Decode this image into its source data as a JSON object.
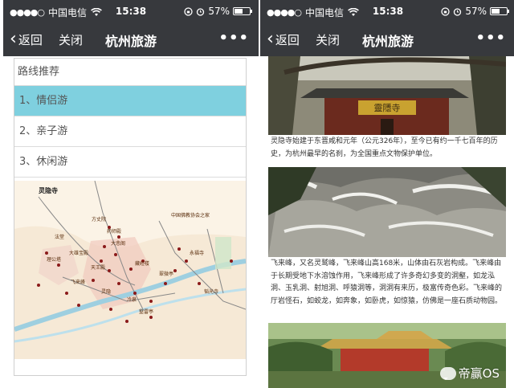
{
  "status_bar": {
    "signal_dots": "●●●●○",
    "carrier": "中国电信",
    "time": "15:38",
    "battery_percent": "57%",
    "battery_level": 0.57
  },
  "nav": {
    "back_label": "返回",
    "close_label": "关闭",
    "title": "杭州旅游",
    "more_label": "•••"
  },
  "routes": {
    "header": "路线推荐",
    "items": [
      {
        "label": "1、情侣游",
        "active": true
      },
      {
        "label": "2、亲子游",
        "active": false
      },
      {
        "label": "3、休闲游",
        "active": false
      }
    ]
  },
  "map": {
    "labels": [
      "灵隐寺",
      "中国佛教协会之家",
      "方丈院",
      "药师殿",
      "法堂",
      "大悲阁",
      "藏经楼",
      "大雄宝殿",
      "天王殿",
      "灵隐",
      "理公塔",
      "飞来峰",
      "冷泉",
      "壑雷亭",
      "翠微亭",
      "永福寺",
      "韬光寺"
    ]
  },
  "article": {
    "caption1": "灵隐寺始建于东晋咸和元年（公元326年），至今已有约一千七百年的历史，为杭州最早的名刹，为全国重点文物保护单位。",
    "caption2": "飞来峰，又名灵鹫峰，飞来峰山高168米，山体由石灰岩构成。飞来峰由于长期受地下水溶蚀作用，飞来峰形成了许多奇幻多变的洞壑，如龙泓洞、玉乳洞、射旭洞、呼猿洞等，洞洞有来历，极富传奇色彩。飞来峰的厅岩怪石，如蛟龙，如奔象，如卧虎，如惊猿，仿佛是一座石质动物园。",
    "plaque_text": "靈隱寺",
    "watermark": "帝赢OS"
  }
}
